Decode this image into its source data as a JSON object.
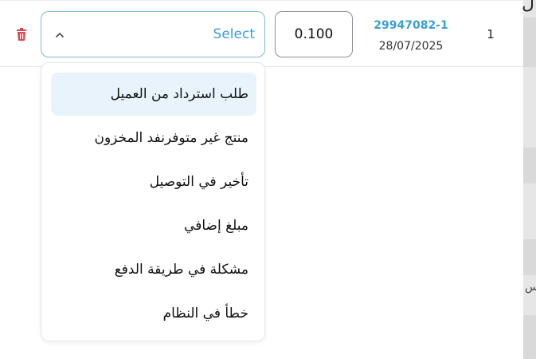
{
  "row": {
    "index": "1",
    "order_id": "29947082-1",
    "order_date": "28/07/2025",
    "quantity": "0.100"
  },
  "reason_select": {
    "label": "Select",
    "expanded": true,
    "options": [
      "طلب استرداد من العميل",
      "منتج غير متوفرنفد المخزون",
      "تأخير في التوصيل",
      "مبلغ إضافي",
      "مشكلة في طريقة الدفع",
      "خطأ في النظام"
    ],
    "highlighted_option_index": 0
  },
  "colors": {
    "accent": "#3aa0d2",
    "delete": "#e0454f",
    "highlight": "#e8f3fb"
  }
}
